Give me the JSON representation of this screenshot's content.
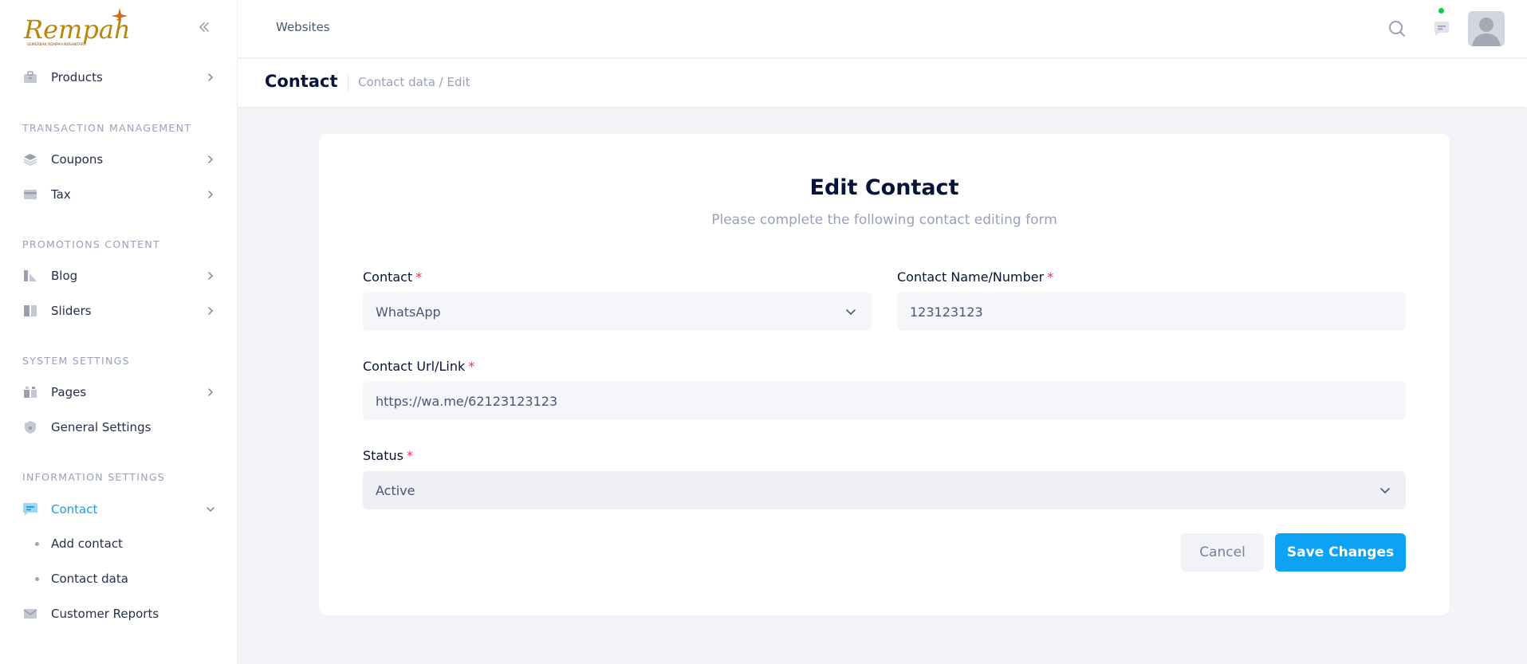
{
  "brand": {
    "logo_text": "Rempah",
    "logo_tagline": "SEMERBAK REMPAH NUSANTARA"
  },
  "sidebar": {
    "items": [
      {
        "label": "Products",
        "icon": "box-icon"
      },
      {
        "label": "Coupons",
        "icon": "layers-icon"
      },
      {
        "label": "Tax",
        "icon": "credit-card-icon"
      },
      {
        "label": "Blog",
        "icon": "blog-icon"
      },
      {
        "label": "Sliders",
        "icon": "sliders-icon"
      },
      {
        "label": "Pages",
        "icon": "gift-icon"
      },
      {
        "label": "General Settings",
        "icon": "shield-icon"
      },
      {
        "label": "Contact",
        "icon": "message-icon"
      },
      {
        "label": "Customer Reports",
        "icon": "mail-icon"
      }
    ],
    "sections": {
      "transaction": "TRANSACTION MANAGEMENT",
      "promotions": "PROMOTIONS CONTENT",
      "system": "SYSTEM SETTINGS",
      "information": "INFORMATION SETTINGS"
    },
    "contact_sub": [
      {
        "label": "Add contact"
      },
      {
        "label": "Contact data"
      }
    ]
  },
  "header": {
    "title": "Websites"
  },
  "page": {
    "title": "Contact",
    "breadcrumb": "Contact data / Edit"
  },
  "form": {
    "title": "Edit Contact",
    "subtitle": "Please complete the following contact editing form",
    "required_mark": "*",
    "contact": {
      "label": "Contact",
      "value": "WhatsApp"
    },
    "contact_name": {
      "label": "Contact Name/Number",
      "value": "123123123"
    },
    "contact_url": {
      "label": "Contact Url/Link",
      "value": "https://wa.me/62123123123"
    },
    "status": {
      "label": "Status",
      "value": "Active"
    },
    "cancel_label": "Cancel",
    "save_label": "Save Changes"
  },
  "colors": {
    "accent": "#0ca3f5",
    "active_nav": "#1b9ee8",
    "required": "#f8285a",
    "online": "#17c653"
  }
}
